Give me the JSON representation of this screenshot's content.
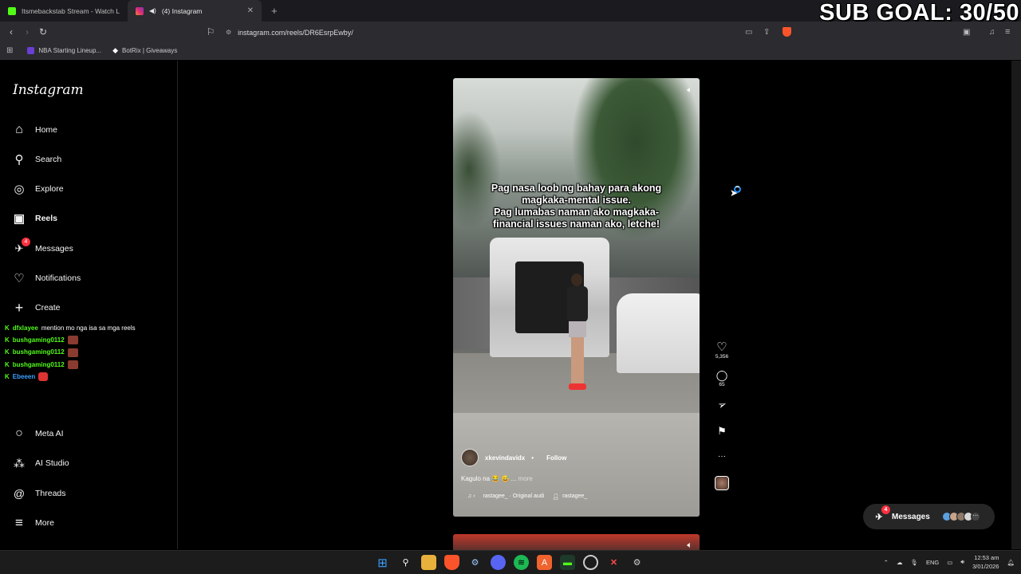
{
  "overlay": {
    "sub_goal": "SUB GOAL: 30/50"
  },
  "browser": {
    "tabs": [
      {
        "title": "Itsmebackstab Stream - Watch Live o",
        "favicon_color": "#53fc18",
        "active": false
      },
      {
        "title": "(4) Instagram",
        "favicon_color": "#e1306c",
        "active": true
      }
    ],
    "url": "instagram.com/reels/DR6EsrpEwby/",
    "bookmarks": [
      {
        "label": "NBA Starting Lineup...",
        "icon_color": "#6a3fd3"
      },
      {
        "label": "BotRix | Giveaways",
        "icon_color": "#ffffff"
      }
    ]
  },
  "sidebar": {
    "logo": "Instagram",
    "items": [
      {
        "label": "Home",
        "icon": "home-icon",
        "glyph": "⌂"
      },
      {
        "label": "Search",
        "icon": "search-icon",
        "glyph": "⚲"
      },
      {
        "label": "Explore",
        "icon": "compass-icon",
        "glyph": "◎"
      },
      {
        "label": "Reels",
        "icon": "reels-icon",
        "glyph": "▣"
      },
      {
        "label": "Messages",
        "icon": "messenger-icon",
        "glyph": "✈",
        "badge": "4"
      },
      {
        "label": "Notifications",
        "icon": "heart-icon",
        "glyph": "♡"
      },
      {
        "label": "Create",
        "icon": "plus-icon",
        "glyph": "+"
      }
    ],
    "bottom_items": [
      {
        "label": "Meta AI",
        "icon": "meta-ai-icon",
        "glyph": "○"
      },
      {
        "label": "AI Studio",
        "icon": "ai-studio-icon",
        "glyph": "⁂"
      },
      {
        "label": "Threads",
        "icon": "threads-icon",
        "glyph": "@"
      },
      {
        "label": "More",
        "icon": "menu-icon",
        "glyph": "≡"
      }
    ]
  },
  "chat": [
    {
      "user": "dfxlayee",
      "message": "mention mo nga isa sa mga reels",
      "color": "green"
    },
    {
      "user": "bushgaming0112",
      "message": "",
      "color": "green"
    },
    {
      "user": "bushgaming0112",
      "message": "",
      "color": "green"
    },
    {
      "user": "bushgaming0112",
      "message": "",
      "color": "green"
    },
    {
      "user": "Ebeeen",
      "message": "",
      "color": "blue"
    }
  ],
  "reel": {
    "caption_lines": [
      "Pag nasa loob ng bahay para akong",
      "magkaka-mental issue.",
      "Pag lumabas naman ako magkaka-",
      "financial issues naman ako, letche!"
    ],
    "username": "xkevindavidx",
    "separator": "•",
    "follow_label": "Follow",
    "description": "Kagulo na 😂 😅 ...",
    "more_label": "more",
    "audio_note_icon": "♫ ›",
    "audio": "rastagee_ · Original audi",
    "audio_user": "rastagee_"
  },
  "actions": [
    {
      "name": "like",
      "glyph": "♡",
      "count": "5,356"
    },
    {
      "name": "comment",
      "glyph": "◯",
      "count": "65"
    },
    {
      "name": "share",
      "glyph": "➢",
      "count": ""
    },
    {
      "name": "save",
      "glyph": "⚑",
      "count": ""
    },
    {
      "name": "more",
      "glyph": "···",
      "count": ""
    }
  ],
  "messages_pill": {
    "label": "Messages",
    "badge": "4"
  },
  "taskbar": {
    "language": "ENG",
    "time": "12:53 am",
    "date": "3/01/2026"
  },
  "colors": {
    "accent": "#0095f6",
    "badge": "#ff3040",
    "kick_green": "#53fc18"
  }
}
